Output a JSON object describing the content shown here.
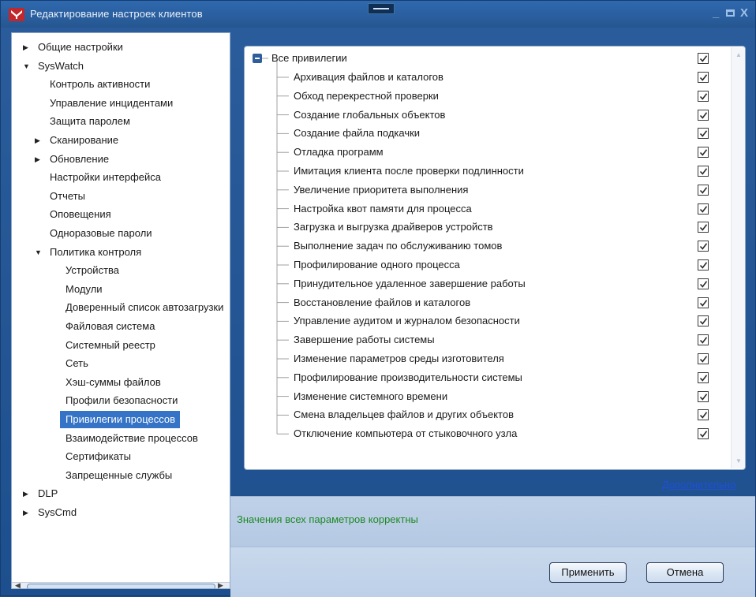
{
  "window": {
    "title": "Редактирование настроек клиентов",
    "controls": [
      "_",
      "□",
      "X"
    ]
  },
  "tree": {
    "items": [
      {
        "label": "Общие настройки",
        "level": 0,
        "arrow": "▶"
      },
      {
        "label": "SysWatch",
        "level": 0,
        "arrow": "▼"
      },
      {
        "label": "Контроль активности",
        "level": 1,
        "arrow": ""
      },
      {
        "label": "Управление инцидентами",
        "level": 1,
        "arrow": ""
      },
      {
        "label": "Защита паролем",
        "level": 1,
        "arrow": ""
      },
      {
        "label": "Сканирование",
        "level": 1,
        "arrow": "▶"
      },
      {
        "label": "Обновление",
        "level": 1,
        "arrow": "▶"
      },
      {
        "label": "Настройки интерфейса",
        "level": 1,
        "arrow": ""
      },
      {
        "label": "Отчеты",
        "level": 1,
        "arrow": ""
      },
      {
        "label": "Оповещения",
        "level": 1,
        "arrow": ""
      },
      {
        "label": "Одноразовые пароли",
        "level": 1,
        "arrow": ""
      },
      {
        "label": "Политика контроля",
        "level": 1,
        "arrow": "▼"
      },
      {
        "label": "Устройства",
        "level": 2,
        "arrow": ""
      },
      {
        "label": "Модули",
        "level": 2,
        "arrow": ""
      },
      {
        "label": "Доверенный список автозагрузки",
        "level": 2,
        "arrow": ""
      },
      {
        "label": "Файловая система",
        "level": 2,
        "arrow": ""
      },
      {
        "label": "Системный реестр",
        "level": 2,
        "arrow": ""
      },
      {
        "label": "Сеть",
        "level": 2,
        "arrow": ""
      },
      {
        "label": "Хэш-суммы файлов",
        "level": 2,
        "arrow": ""
      },
      {
        "label": "Профили безопасности",
        "level": 2,
        "arrow": ""
      },
      {
        "label": "Привилегии процессов",
        "level": 2,
        "arrow": "",
        "selected": true
      },
      {
        "label": "Взаимодействие процессов",
        "level": 2,
        "arrow": ""
      },
      {
        "label": "Сертификаты",
        "level": 2,
        "arrow": ""
      },
      {
        "label": "Запрещенные службы",
        "level": 2,
        "arrow": ""
      },
      {
        "label": "DLP",
        "level": 0,
        "arrow": "▶"
      },
      {
        "label": "SysCmd",
        "level": 0,
        "arrow": "▶"
      }
    ]
  },
  "privileges": {
    "root_label": "Все привилегии",
    "root_checked": true,
    "items": [
      {
        "label": "Архивация файлов и каталогов",
        "checked": true
      },
      {
        "label": "Обход перекрестной проверки",
        "checked": true
      },
      {
        "label": "Создание глобальных объектов",
        "checked": true
      },
      {
        "label": "Создание файла подкачки",
        "checked": true
      },
      {
        "label": "Отладка программ",
        "checked": true
      },
      {
        "label": "Имитация клиента после проверки подлинности",
        "checked": true
      },
      {
        "label": "Увеличение приоритета выполнения",
        "checked": true
      },
      {
        "label": "Настройка квот памяти для процесса",
        "checked": true
      },
      {
        "label": "Загрузка и выгрузка драйверов устройств",
        "checked": true
      },
      {
        "label": "Выполнение задач по обслуживанию томов",
        "checked": true
      },
      {
        "label": "Профилирование одного процесса",
        "checked": true
      },
      {
        "label": "Принудительное удаленное завершение работы",
        "checked": true
      },
      {
        "label": "Восстановление файлов и каталогов",
        "checked": true
      },
      {
        "label": "Управление аудитом и журналом безопасности",
        "checked": true
      },
      {
        "label": "Завершение работы системы",
        "checked": true
      },
      {
        "label": "Изменение параметров среды изготовителя",
        "checked": true
      },
      {
        "label": "Профилирование производительности системы",
        "checked": true
      },
      {
        "label": "Изменение системного времени",
        "checked": true
      },
      {
        "label": "Смена владельцев файлов и других объектов",
        "checked": true
      },
      {
        "label": "Отключение компьютера от стыковочного узла",
        "checked": true
      }
    ]
  },
  "more_link": "Дополнительно",
  "status": "Значения всех параметров корректны",
  "buttons": {
    "apply": "Применить",
    "cancel": "Отмена"
  },
  "colors": {
    "title_bar": "#2a5fa0",
    "selection": "#3473c6",
    "status_text": "#1f8a24",
    "link": "#1f4fd8"
  }
}
